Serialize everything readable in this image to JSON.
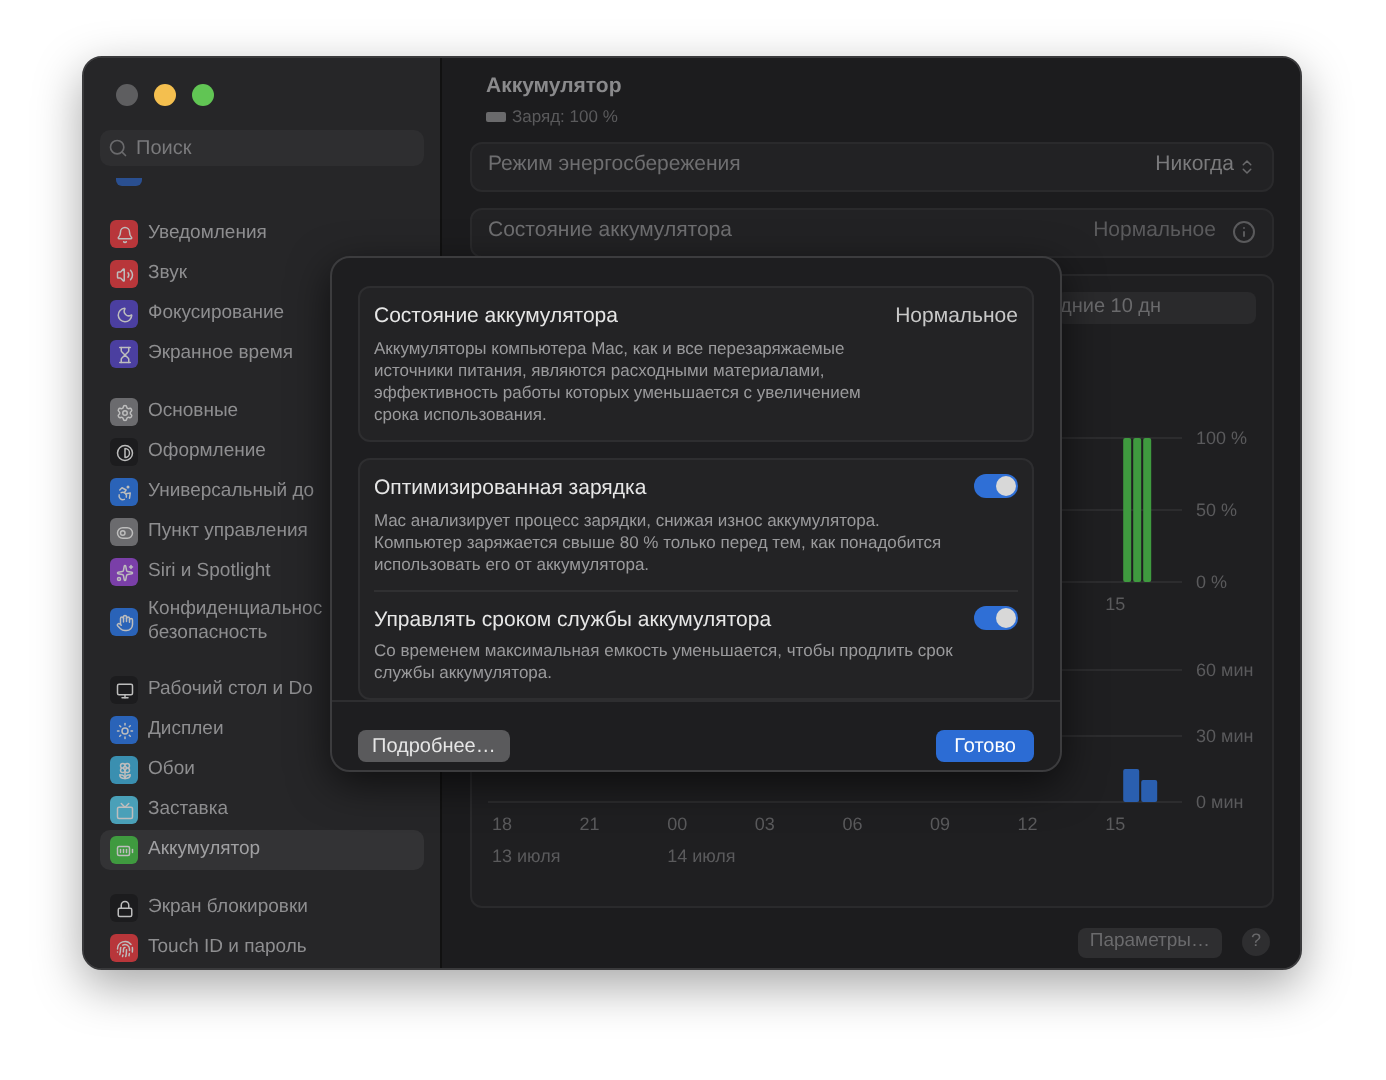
{
  "sidebar": {
    "search": {
      "placeholder": "Поиск"
    },
    "groups": [
      [
        {
          "label": "Уведомления",
          "selected": false,
          "color": "#b8363a"
        },
        {
          "label": "Звук",
          "selected": false,
          "color": "#b8363a"
        },
        {
          "label": "Фокусирование",
          "selected": false,
          "color": "#4b3fa0"
        },
        {
          "label": "Экранное время",
          "selected": false,
          "color": "#4b3fa0"
        }
      ],
      [
        {
          "label": "Основные",
          "selected": false,
          "color": "#6b6b6e"
        },
        {
          "label": "Оформление",
          "selected": false,
          "color": "#1c1c1e"
        },
        {
          "label": "Универсальный до",
          "selected": false,
          "color": "#2a63b8"
        },
        {
          "label": "Пункт управления",
          "selected": false,
          "color": "#6b6b6e"
        },
        {
          "label": "Siri и Spotlight",
          "selected": false,
          "color": "#7a3fa8"
        },
        {
          "label": "Конфиденциальнос\nбезопасность",
          "selected": false,
          "color": "#2a63b8"
        }
      ],
      [
        {
          "label": "Рабочий стол и Do",
          "selected": false,
          "color": "#1c1c1e"
        },
        {
          "label": "Дисплеи",
          "selected": false,
          "color": "#2a63b8"
        },
        {
          "label": "Обои",
          "selected": false,
          "color": "#3a8fb0"
        },
        {
          "label": "Заставка",
          "selected": false,
          "color": "#4aa0b8"
        },
        {
          "label": "Аккумулятор",
          "selected": true,
          "color": "#3f9a3f"
        }
      ],
      [
        {
          "label": "Экран блокировки",
          "selected": false,
          "color": "#1c1c1e"
        },
        {
          "label": "Touch ID и пароль",
          "selected": false,
          "color": "#b8363a"
        }
      ]
    ]
  },
  "header": {
    "title": "Аккумулятор",
    "subtitle": "Заряд: 100 %"
  },
  "settings_rows": [
    {
      "kind": "popup",
      "label": "Режим энергосбережения",
      "value": "Никогда"
    },
    {
      "kind": "info",
      "label": "Состояние аккумулятора",
      "value": "Нормальное"
    }
  ],
  "usage_card": {
    "segment_label": "дние 10 дн",
    "level_chart": {
      "chart_data": {
        "type": "bar",
        "categories": [
          "15"
        ],
        "ylim": [
          0,
          100
        ],
        "yticks": [
          {
            "value": 100,
            "label": "100 %"
          },
          {
            "value": 50,
            "label": "50 %"
          },
          {
            "value": 0,
            "label": "0 %"
          }
        ],
        "series": [
          {
            "color": "#3f9a3f",
            "values": [
              100
            ]
          },
          {
            "color": "#3f9a3f",
            "values": [
              100
            ]
          },
          {
            "color": "#3f9a3f",
            "values": [
              100
            ]
          }
        ]
      }
    },
    "activity_chart": {
      "chart_data": {
        "type": "bar",
        "categories": [
          "18",
          "21",
          "00",
          "03",
          "06",
          "09",
          "12",
          "15"
        ],
        "ylim": [
          0,
          60
        ],
        "yticks": [
          {
            "value": 60,
            "label": "60 мин"
          },
          {
            "value": 30,
            "label": "30 мин"
          },
          {
            "value": 0,
            "label": "0 мин"
          }
        ],
        "series": [
          {
            "color": "#2a5fb0",
            "values": [
              null,
              null,
              null,
              null,
              null,
              null,
              null,
              15
            ]
          },
          {
            "color": "#2a5fb0",
            "values": [
              null,
              null,
              null,
              null,
              null,
              null,
              null,
              10
            ]
          }
        ]
      },
      "dates": [
        "13 июля",
        "14 июля"
      ]
    }
  },
  "footer": {
    "options_button": "Параметры…",
    "help_button": "?"
  },
  "sheet": {
    "status": {
      "title": "Состояние аккумулятора",
      "value": "Нормальное",
      "description": "Аккумуляторы компьютера Mac, как и все перезаряжаемые источники питания, являются расходными материалами, эффективность работы которых уменьшается с увеличением срока использования."
    },
    "toggles": [
      {
        "title": "Оптимизированная зарядка",
        "description": "Mac анализирует процесс зарядки, снижая износ аккумулятора. Компьютер заряжается свыше 80 % только перед тем, как понадобится использовать его от аккумулятора.",
        "on": true
      },
      {
        "title": "Управлять сроком службы аккумулятора",
        "description": "Со временем максимальная емкость уменьшается, чтобы продлить срок службы аккумулятора.",
        "on": true
      }
    ],
    "buttons": [
      {
        "kind": "secondary",
        "label": "Подробнее…"
      },
      {
        "kind": "primary",
        "label": "Готово"
      }
    ]
  }
}
